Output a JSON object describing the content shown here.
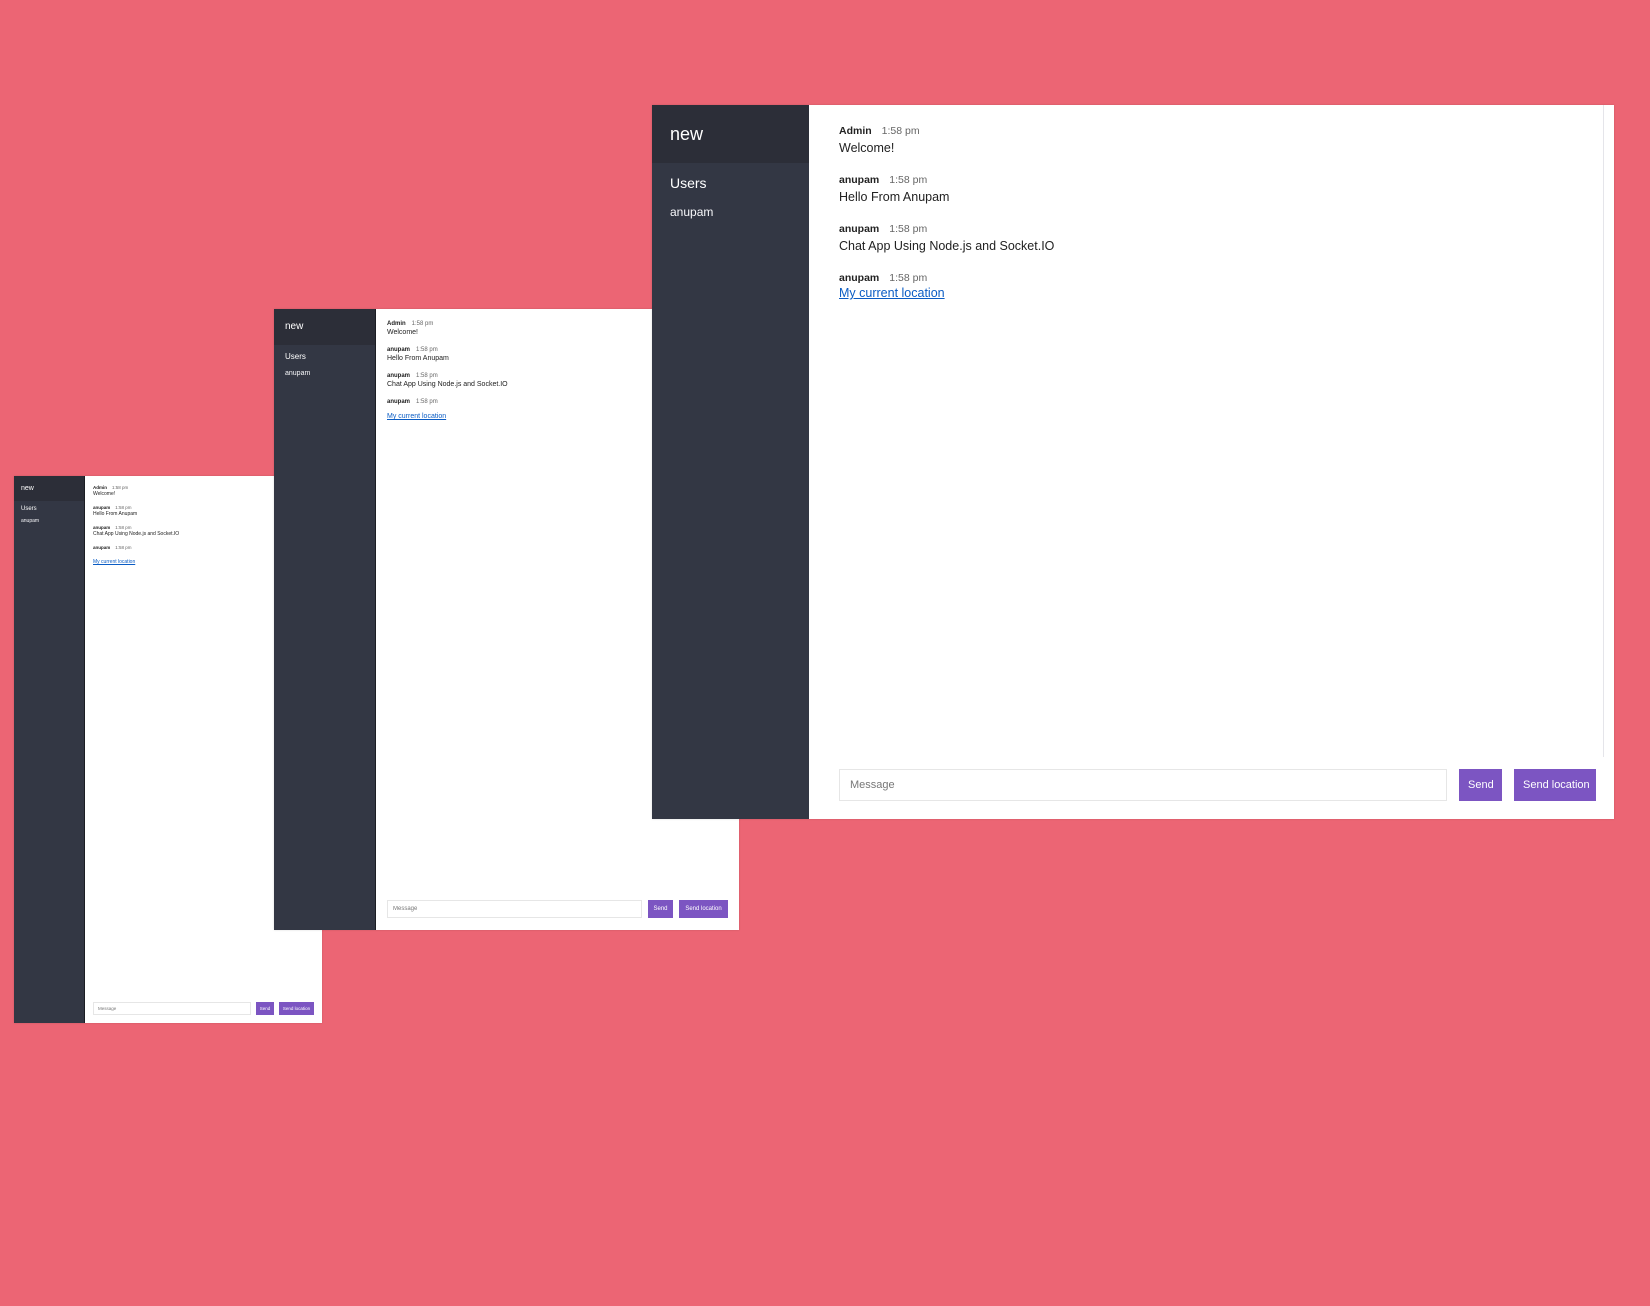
{
  "background_color": "#ec6574",
  "accent_color": "#7c55c2",
  "sidebar_color": "#333744",
  "room": "new",
  "users_heading": "Users",
  "users": [
    "anupam"
  ],
  "messages": [
    {
      "username": "Admin",
      "time": "1:58 pm",
      "text": "Welcome!"
    },
    {
      "username": "anupam",
      "time": "1:58 pm",
      "text": "Hello From Anupam"
    },
    {
      "username": "anupam",
      "time": "1:58 pm",
      "text": "Chat App Using Node.js and Socket.IO"
    },
    {
      "username": "anupam",
      "time": "1:58 pm",
      "link_text": "My current location"
    }
  ],
  "composer": {
    "placeholder": "Message",
    "send_label": "Send",
    "location_label": "Send location"
  }
}
